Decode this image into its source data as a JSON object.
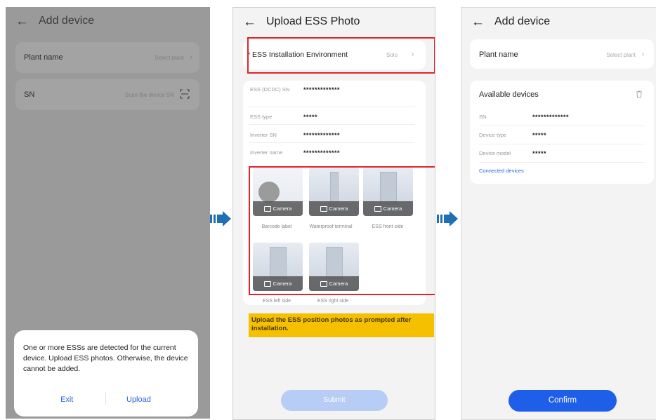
{
  "screen1": {
    "title": "Add device",
    "plant_label": "Plant name",
    "plant_value": "Select plant",
    "sn_label": "SN",
    "sn_value": "Scan the device SN",
    "dialog_message": "One or more ESSs are detected for the current device. Upload ESS photos. Otherwise, the device cannot be added.",
    "exit_label": "Exit",
    "upload_label": "Upload"
  },
  "screen2": {
    "title": "Upload ESS Photo",
    "env_label": "ESS Installation Environment",
    "env_value": "Solo",
    "fields": [
      {
        "label": "ESS (DCDC) SN",
        "value": "*************"
      },
      {
        "label": "ESS type",
        "value": "*****"
      },
      {
        "label": "Inverter SN",
        "value": "*************"
      },
      {
        "label": "Inverter name",
        "value": "*************"
      }
    ],
    "photos": [
      {
        "button": "Camera",
        "caption": "Barcode label"
      },
      {
        "button": "Camera",
        "caption": "Waterproof terminal"
      },
      {
        "button": "Camera",
        "caption": "ESS front side"
      },
      {
        "button": "Camera",
        "caption": "ESS left side"
      },
      {
        "button": "Camera",
        "caption": "ESS right side"
      }
    ],
    "notice": "Upload the ESS position photos as prompted after installation.",
    "submit_label": "Submit"
  },
  "screen3": {
    "title": "Add device",
    "plant_label": "Plant name",
    "plant_value": "Select plant",
    "available_title": "Available devices",
    "rows": [
      {
        "label": "SN",
        "value": "*************"
      },
      {
        "label": "Device type",
        "value": "*****"
      },
      {
        "label": "Device model",
        "value": "*****"
      }
    ],
    "connected_link": "Connected devices",
    "confirm_label": "Confirm"
  },
  "colors": {
    "accent_blue": "#1f5ee8",
    "disabled_blue": "#b7cdf5",
    "highlight_red": "#e0242c",
    "notice_yellow": "#f5c000",
    "link_blue": "#2b63d6"
  }
}
